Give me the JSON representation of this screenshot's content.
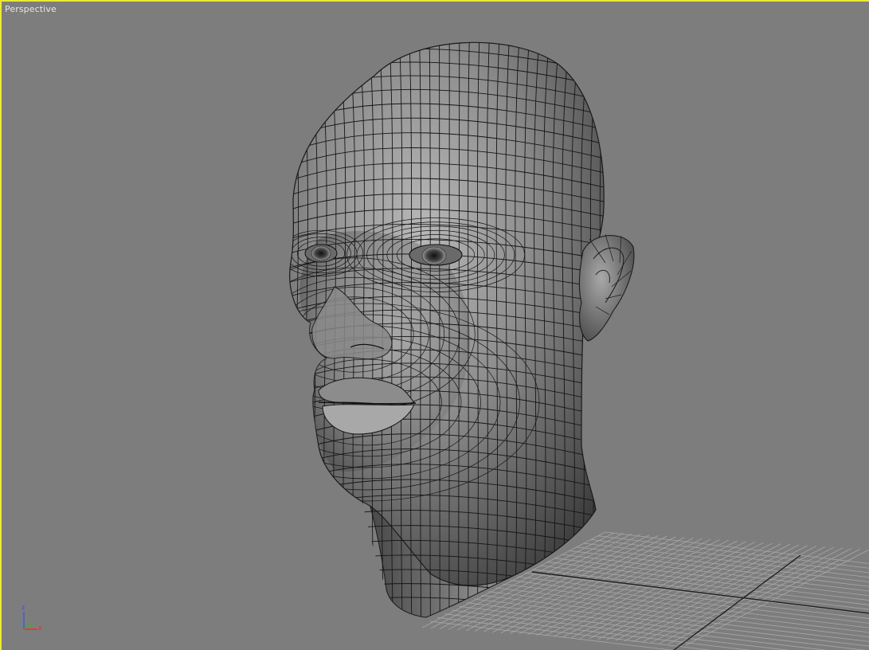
{
  "viewport": {
    "label": "Perspective",
    "active_border_color": "#f0f000",
    "background_color": "#7d7d7d"
  },
  "scene": {
    "object": "head-mesh",
    "shading": "smooth + edged faces",
    "grid": true
  },
  "axis_gizmo": {
    "z_label": "z",
    "y_label": "y",
    "x_label": "x",
    "colors": {
      "x": "#ff2020",
      "y": "#20c020",
      "z": "#3050ff"
    }
  }
}
